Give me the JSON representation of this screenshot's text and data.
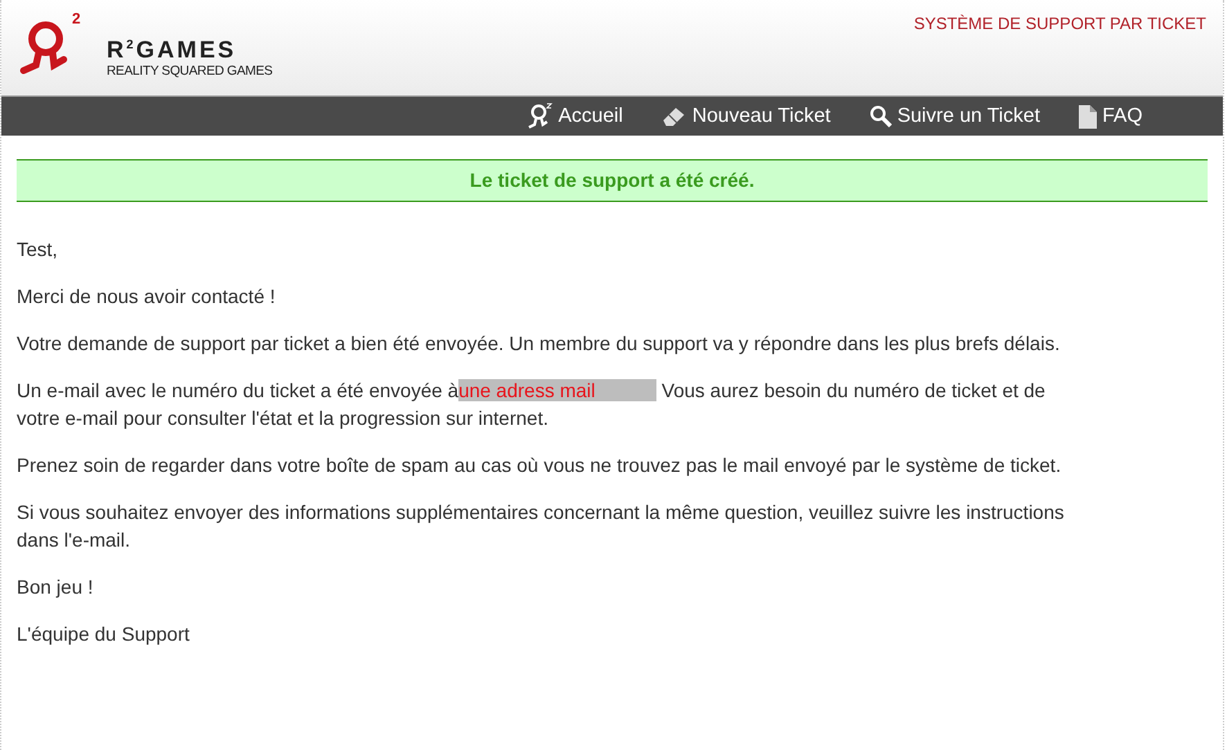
{
  "header": {
    "logo_mark": "2",
    "brand": "R$^{2}$GAMES",
    "tagline": "REALITY SQUARED GAMES",
    "site_title": "SYSTÈME DE SUPPORT PAR TICKET"
  },
  "nav": [
    {
      "kind": "home",
      "label": "Accueil"
    },
    {
      "kind": "new",
      "label": "Nouveau Ticket"
    },
    {
      "kind": "track",
      "label": "Suivre un Ticket"
    },
    {
      "kind": "faq",
      "label": "FAQ"
    }
  ],
  "notice": "Le ticket de support a été créé.",
  "paragraphs": [
    {
      "kind": "text",
      "text": "Test,"
    },
    {
      "kind": "text",
      "text": "Merci de nous avoir contacté !"
    },
    {
      "kind": "text",
      "text": "Votre demande de support par ticket a bien été envoyée. Un membre du support va y répondre dans les plus brefs délais."
    },
    {
      "kind": "email",
      "before": "Un e-mail avec le numéro du ticket a été envoyée à",
      "email": "une adress mail",
      "after": "Vous aurez besoin du numéro de ticket et de votre e-mail pour consulter l'état et la progression sur internet."
    },
    {
      "kind": "text",
      "text": "Prenez soin de regarder dans votre boîte de spam au cas où vous ne trouvez pas le mail envoyé par le système de ticket."
    },
    {
      "kind": "text",
      "text": "Si vous souhaitez envoyer des informations supplémentaires concernant la même question, veuillez suivre les instructions dans l'e-mail."
    },
    {
      "kind": "text",
      "text": "Bon jeu !"
    },
    {
      "kind": "text",
      "text": "L'équipe du Support"
    }
  ]
}
